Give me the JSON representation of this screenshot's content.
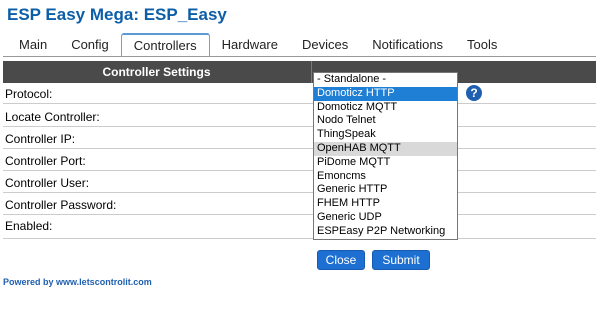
{
  "app": {
    "title": "ESP Easy Mega: ESP_Easy"
  },
  "tabs": [
    {
      "label": "Main"
    },
    {
      "label": "Config"
    },
    {
      "label": "Controllers",
      "active": true
    },
    {
      "label": "Hardware"
    },
    {
      "label": "Devices"
    },
    {
      "label": "Notifications"
    },
    {
      "label": "Tools"
    }
  ],
  "table": {
    "header": "Controller Settings"
  },
  "fields": [
    {
      "label": "Protocol:"
    },
    {
      "label": "Locate Controller:"
    },
    {
      "label": "Controller IP:"
    },
    {
      "label": "Controller Port:"
    },
    {
      "label": "Controller User:"
    },
    {
      "label": "Controller Password:"
    },
    {
      "label": "Enabled:"
    }
  ],
  "protocol_list": {
    "options": [
      "- Standalone -",
      "Domoticz HTTP",
      "Domoticz MQTT",
      "Nodo Telnet",
      "ThingSpeak",
      "OpenHAB MQTT",
      "PiDome MQTT",
      "Emoncms",
      "Generic HTTP",
      "FHEM HTTP",
      "Generic UDP",
      "ESPEasy P2P Networking"
    ],
    "selected": "Domoticz HTTP",
    "hovered": "OpenHAB MQTT"
  },
  "help": {
    "glyph": "?",
    "icon": "help-icon"
  },
  "buttons": {
    "close": "Close",
    "submit": "Submit"
  },
  "footer": {
    "text": "Powered by www.letscontrolit.com"
  },
  "colors": {
    "accent": "#1e6fd2",
    "header_bg": "#4a4a4a",
    "title": "#0c5ea8"
  }
}
